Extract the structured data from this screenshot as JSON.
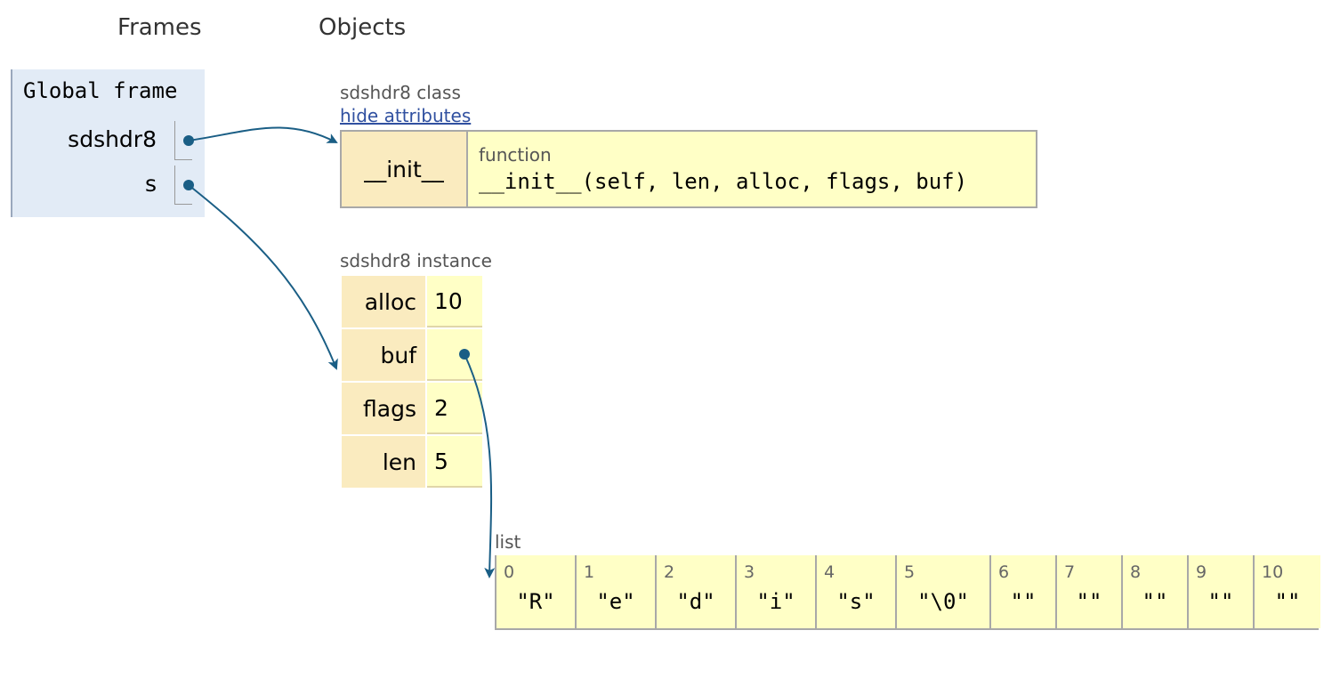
{
  "headings": {
    "frames": "Frames",
    "objects": "Objects"
  },
  "global_frame": {
    "title": "Global frame",
    "vars": [
      {
        "name": "sdshdr8"
      },
      {
        "name": "s"
      }
    ]
  },
  "class_obj": {
    "label": "sdshdr8 class",
    "toggle_link": "hide attributes",
    "attr_name": "__init__",
    "attr_type": "function",
    "attr_signature": "__init__(self, len, alloc, flags, buf)"
  },
  "instance_obj": {
    "label": "sdshdr8 instance",
    "rows": [
      {
        "key": "alloc",
        "value": "10"
      },
      {
        "key": "buf",
        "value": ""
      },
      {
        "key": "flags",
        "value": "2"
      },
      {
        "key": "len",
        "value": "5"
      }
    ]
  },
  "list_obj": {
    "label": "list",
    "cells": [
      {
        "index": "0",
        "value": "\"R\""
      },
      {
        "index": "1",
        "value": "\"e\""
      },
      {
        "index": "2",
        "value": "\"d\""
      },
      {
        "index": "3",
        "value": "\"i\""
      },
      {
        "index": "4",
        "value": "\"s\""
      },
      {
        "index": "5",
        "value": "\"\\0\""
      },
      {
        "index": "6",
        "value": "\"\""
      },
      {
        "index": "7",
        "value": "\"\""
      },
      {
        "index": "8",
        "value": "\"\""
      },
      {
        "index": "9",
        "value": "\"\""
      },
      {
        "index": "10",
        "value": "\"\""
      }
    ]
  },
  "colors": {
    "arrow": "#1a5e85",
    "frame_bg": "#e2ebf6",
    "key_bg": "#faebbf",
    "value_bg": "#ffffc6"
  }
}
